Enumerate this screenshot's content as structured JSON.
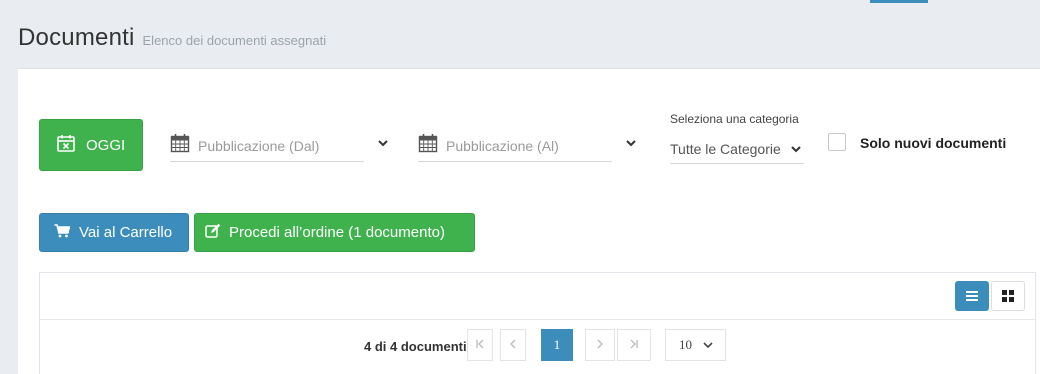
{
  "header": {
    "title": "Documenti",
    "subtitle": "Elenco dei documenti assegnati"
  },
  "filters": {
    "today_button": "OGGI",
    "date_from_placeholder": "Pubblicazione (Dal)",
    "date_to_placeholder": "Pubblicazione (Al)",
    "category_label": "Seleziona una categoria",
    "category_value": "Tutte le Categorie",
    "only_new_label": "Solo nuovi documenti",
    "only_new_checked": false
  },
  "actions": {
    "cart_button": "Vai al Carrello",
    "order_button": "Procedi all’ordine (1 documento)"
  },
  "pagination": {
    "count_text": "4 di 4 documenti",
    "current_page": "1",
    "per_page": "10",
    "first_icon": "⏮",
    "prev_icon": "‹",
    "next_icon": "›",
    "last_icon": "⏭"
  },
  "colors": {
    "primary": "#3c8dbc",
    "success": "#3fb24e",
    "background": "#e9edf1"
  }
}
